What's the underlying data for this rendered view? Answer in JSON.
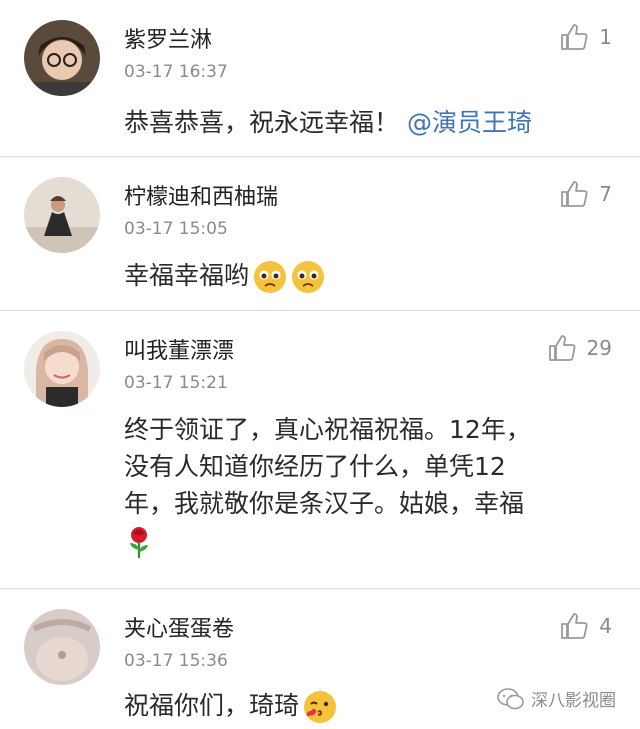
{
  "comments": [
    {
      "username": "紫罗兰淋",
      "time": "03-17 16:37",
      "likes": "1",
      "text": "恭喜恭喜，祝永远幸福！",
      "mention": "@演员王琦"
    },
    {
      "username": "柠檬迪和西柚瑞",
      "time": "03-17 15:05",
      "likes": "7",
      "text": "幸福幸福哟"
    },
    {
      "username": "叫我董漂漂",
      "time": "03-17 15:21",
      "likes": "29",
      "text_line1": "终于领证了，真心祝福祝福。12年，",
      "text_line2": "没有人知道你经历了什么，单凭12",
      "text_line3": "年，我就敬你是条汉子。姑娘，幸福"
    },
    {
      "username": "夹心蛋蛋卷",
      "time": "03-17 15:36",
      "likes": "4",
      "text": "祝福你们，琦琦"
    }
  ],
  "watermark": "深八影视圈",
  "icons": {
    "like": "thumbs-up-icon",
    "emoji_sad": "pleading-face-icon",
    "emoji_kiss": "kiss-face-icon",
    "rose": "rose-icon",
    "watermark": "wechat-icon"
  },
  "colors": {
    "mention": "#3f74b6",
    "meta": "#8a8a8a",
    "divider": "#dcdcdc"
  }
}
